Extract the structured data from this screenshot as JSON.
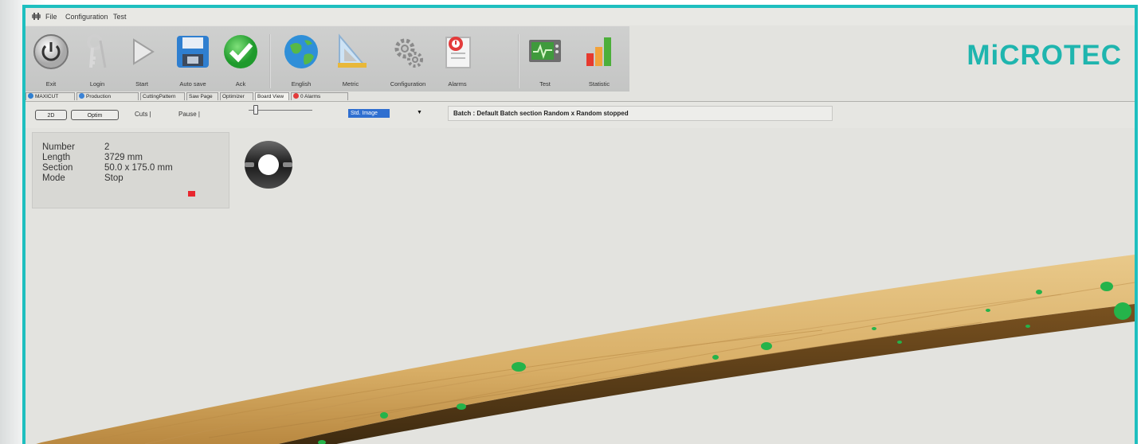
{
  "menu": {
    "items": [
      "File",
      "Configuration",
      "Test"
    ]
  },
  "toolbar": {
    "buttons": [
      {
        "label": "Exit",
        "icon": "power-icon"
      },
      {
        "label": "Login",
        "icon": "key-icon"
      },
      {
        "label": "Start",
        "icon": "play-icon"
      },
      {
        "label": "Auto save",
        "icon": "floppy-disk-icon"
      },
      {
        "label": "Ack",
        "icon": "check-icon"
      },
      {
        "label": "English",
        "icon": "globe-icon"
      },
      {
        "label": "Metric",
        "icon": "ruler-triangle-icon"
      },
      {
        "label": "Configuration",
        "icon": "gears-icon"
      },
      {
        "label": "Alarms",
        "icon": "alarm-clipboard-icon"
      },
      {
        "label": "Test",
        "icon": "monitor-icon"
      },
      {
        "label": "Statistic",
        "icon": "bar-chart-icon"
      }
    ]
  },
  "brand": {
    "name": "MiCROTEC",
    "color": "#1fb5ae"
  },
  "tabs": [
    {
      "label": "MAXICUT",
      "icon": "globe-small-icon"
    },
    {
      "label": "Production",
      "icon": "blue-dot-icon"
    },
    {
      "label": "CuttingPattern"
    },
    {
      "label": "Saw Page"
    },
    {
      "label": "Optimizer"
    },
    {
      "label": "Board View",
      "active": true
    },
    {
      "label": "0 Alarms",
      "icon": "alarm-red-icon"
    }
  ],
  "controls": {
    "view_2d_label": "2D",
    "optim_label": "Optim",
    "cuts_label": "Cuts |",
    "pause_label": "Pause |",
    "image_select": {
      "selected": "Std. Image"
    },
    "status": "Batch : Default Batch   section Random x Random   stopped"
  },
  "board_info": {
    "number_label": "Number",
    "number_value": "2",
    "length_label": "Length",
    "length_value": "3729 mm",
    "section_label": "Section",
    "section_value": "50.0 x 175.0 mm",
    "mode_label": "Mode",
    "mode_value": "Stop",
    "mode_color": "#e8262e"
  },
  "colors": {
    "frame": "#1ebfbf",
    "defect": "#25b34a",
    "wood": "#d7ae66"
  }
}
